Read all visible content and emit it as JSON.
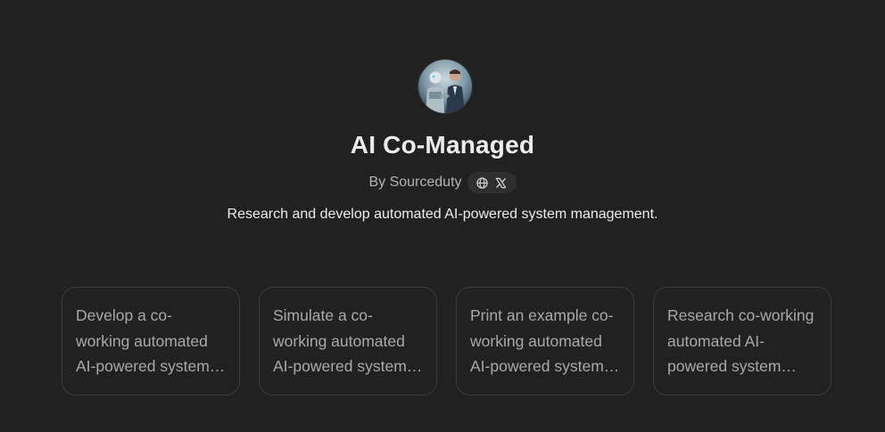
{
  "gpt": {
    "name": "AI Co-Managed",
    "byline": "By Sourceduty",
    "description": "Research and develop automated AI-powered system management.",
    "avatar_icon": "robot-and-man-handshake-image",
    "links": [
      {
        "icon": "globe-icon"
      },
      {
        "icon": "x-logo-icon"
      }
    ]
  },
  "conversation_starters": [
    {
      "text": "Develop a co-working automated AI-powered system management"
    },
    {
      "text": "Simulate a co-working automated AI-powered system management"
    },
    {
      "text": "Print an example co-working automated AI-powered system management"
    },
    {
      "text": "Research co-working automated AI-powered system management"
    }
  ],
  "colors": {
    "background": "#212121",
    "title": "#ececec",
    "muted_text": "#b4b4b4",
    "starter_text": "#a9a9a9",
    "card_border": "#3c3c3c",
    "pill_background": "#2f2f2f"
  }
}
